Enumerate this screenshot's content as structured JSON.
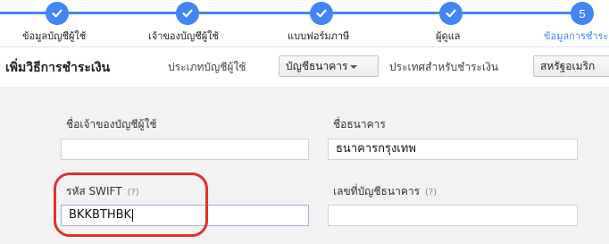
{
  "steps": [
    {
      "label": "ข้อมูลบัญชีผู้ใช้",
      "state": "done"
    },
    {
      "label": "เจ้าของบัญชีผู้ใช้",
      "state": "done"
    },
    {
      "label": "แบบฟอร์มภาษี",
      "state": "done"
    },
    {
      "label": "ผู้ดูแล",
      "state": "done"
    },
    {
      "label": "ข้อมูลการชำระเงิน",
      "state": "active",
      "number": "5"
    }
  ],
  "toolbar": {
    "title": "เพิ่มวิธีการชำระเงิน",
    "account_type_label": "ประเภทบัญชีผู้ใช้",
    "account_type_value": "บัญชีธนาคาร",
    "country_label": "ประเทศสำหรับชำระเงิน",
    "country_value": "สหรัฐอเมริก"
  },
  "form": {
    "owner_name_label": "ชื่อเจ้าของบัญชีผู้ใช้",
    "owner_name_value": "",
    "bank_name_label": "ชื่อธนาคาร",
    "bank_name_value": "ธนาคารกรุงเทพ",
    "swift_label": "รหัส SWIFT",
    "swift_help": "(?)",
    "swift_value": "BKKBTHBK",
    "account_number_label": "เลขที่บัญชีธนาคาร",
    "account_number_help": "(?)",
    "account_number_value": ""
  },
  "colors": {
    "accent": "#4285f4",
    "highlight": "#e03030",
    "panel": "#f2f2f2"
  },
  "icons": {
    "step_done": "check-icon",
    "dropdown": "caret-down-icon"
  }
}
